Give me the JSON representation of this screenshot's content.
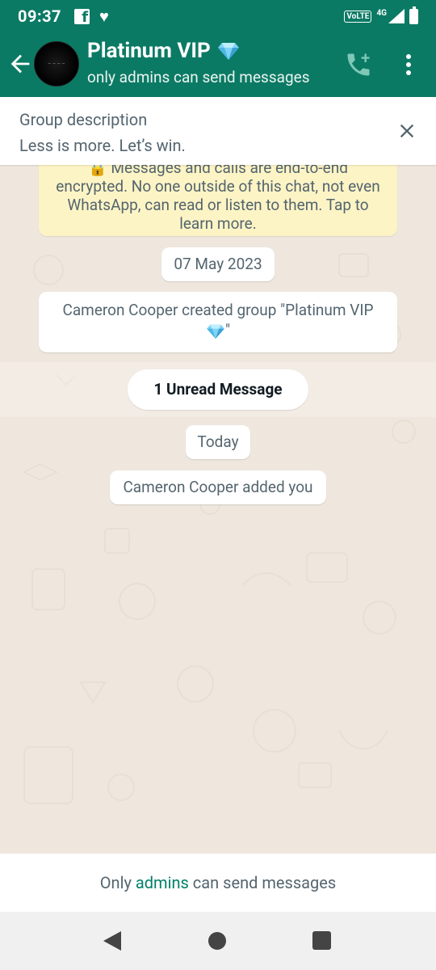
{
  "status_bar": {
    "time": "09:37",
    "network_badge": "VoLTE",
    "network_type": "4G"
  },
  "header": {
    "title": "Platinum VIP",
    "subtitle": "only admins can send messages",
    "title_emoji": "diamond-icon",
    "accent_color": "#0b7a64"
  },
  "description": {
    "title": "Group description",
    "text": "Less is more. Let’s win."
  },
  "messages": {
    "encryption_notice": "🔒 Messages and calls are end-to-end encrypted. No one outside of this chat, not even WhatsApp, can read or listen to them. Tap to learn more.",
    "date_1": "07 May 2023",
    "created_text": "Cameron Cooper created group \"Platinum VIP",
    "created_tail": "\"",
    "unread": "1 Unread Message",
    "date_2": "Today",
    "added_text": "Cameron Cooper added you"
  },
  "footer": {
    "prefix": "Only",
    "link": "admins",
    "suffix": "can send messages"
  }
}
